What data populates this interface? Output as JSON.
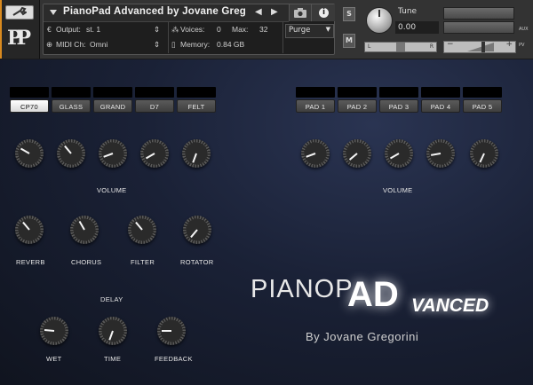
{
  "header": {
    "instrument_name": "PianoPad Advanced by Jovane Greg",
    "logo_text": "PP",
    "output_label": "Output:",
    "output_value": "st. 1",
    "voices_label": "Voices:",
    "voices_value": "0",
    "max_label": "Max:",
    "max_value": "32",
    "midi_label": "MIDI Ch:",
    "midi_value": "Omni",
    "memory_label": "Memory:",
    "memory_value": "0.84 GB",
    "purge_label": "Purge",
    "solo_label": "S",
    "mute_label": "M",
    "tune_label": "Tune",
    "tune_value": "0.00",
    "pan_left": "L",
    "pan_right": "R",
    "aux_label": "AUX",
    "pv_label": "PV"
  },
  "piano": {
    "presets": [
      "CP70",
      "GLASS",
      "GRAND",
      "D7",
      "FELT"
    ],
    "active_preset": "CP70",
    "volume_label": "VOLUME",
    "fx_labels": [
      "REVERB",
      "CHORUS",
      "FILTER",
      "ROTATOR"
    ]
  },
  "pad": {
    "presets": [
      "PAD 1",
      "PAD 2",
      "PAD 3",
      "PAD 4",
      "PAD 5"
    ],
    "volume_label": "VOLUME"
  },
  "delay": {
    "title": "DELAY",
    "labels": [
      "WET",
      "TIME",
      "FEEDBACK"
    ]
  },
  "branding": {
    "main": "PIANOP",
    "highlight": "AD",
    "suffix": "VANCED",
    "byline": "By Jovane Gregorini"
  }
}
